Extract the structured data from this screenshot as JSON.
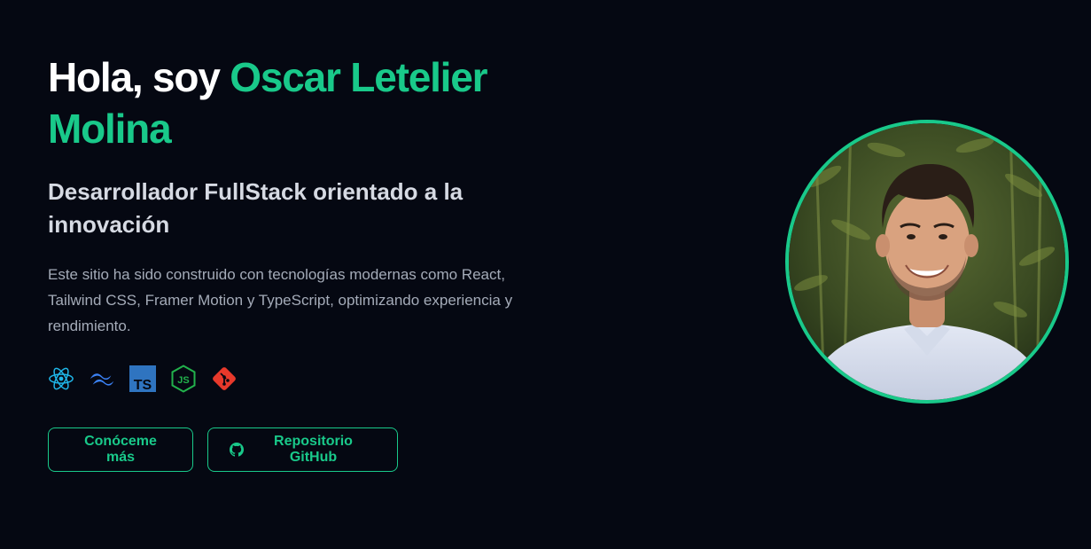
{
  "hero": {
    "title_prefix": "Hola, soy ",
    "title_name": "Oscar Letelier Molina",
    "subtitle": "Desarrollador FullStack orientado a la innovación",
    "description": "Este sitio ha sido construido con tecnologías modernas como React, Tailwind CSS, Framer Motion y TypeScript, optimizando experiencia y rendimiento.",
    "tech_icons": [
      {
        "icon": "react-icon",
        "color": "#1fb6e8"
      },
      {
        "icon": "tailwind-icon",
        "color": "#3b82f6"
      },
      {
        "icon": "typescript-icon",
        "color": "#2f74c0",
        "text": "TS"
      },
      {
        "icon": "nodejs-icon",
        "color": "#22b24c",
        "text": "JS"
      },
      {
        "icon": "git-icon",
        "color": "#e8392b"
      }
    ],
    "buttons": {
      "about_label": "Conóceme más",
      "github_label": "Repositorio GitHub",
      "github_icon": "github-icon"
    },
    "avatar": {
      "icon": "avatar-photo"
    },
    "colors": {
      "accent": "#19c98a",
      "background": "#050812"
    }
  }
}
